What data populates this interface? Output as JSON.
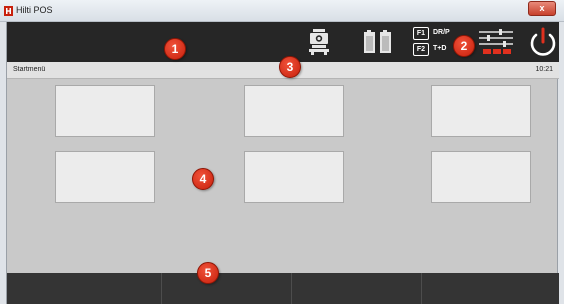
{
  "window": {
    "title": "Hilti POS",
    "close_label": "x",
    "logo_icon": "hilti-logo-icon"
  },
  "toolbar": {
    "instrument_icon": "total-station-icon",
    "battery_icon": "battery-icon",
    "fkeys": [
      {
        "key": "F1",
        "label": "DR/P"
      },
      {
        "key": "F2",
        "label": "T+D"
      }
    ],
    "settings_icon": "settings-sliders-icon",
    "power_icon": "power-icon",
    "accent_color": "#e0301e"
  },
  "statusbar": {
    "title": "Startmenü",
    "time": "10:21"
  },
  "tiles": [
    {
      "label": ""
    },
    {
      "label": ""
    },
    {
      "label": ""
    },
    {
      "label": ""
    },
    {
      "label": ""
    },
    {
      "label": ""
    }
  ],
  "softkeys": [
    {
      "label": ""
    },
    {
      "label": ""
    },
    {
      "label": ""
    },
    {
      "label": ""
    }
  ],
  "callouts": [
    "1",
    "2",
    "3",
    "4",
    "5"
  ]
}
